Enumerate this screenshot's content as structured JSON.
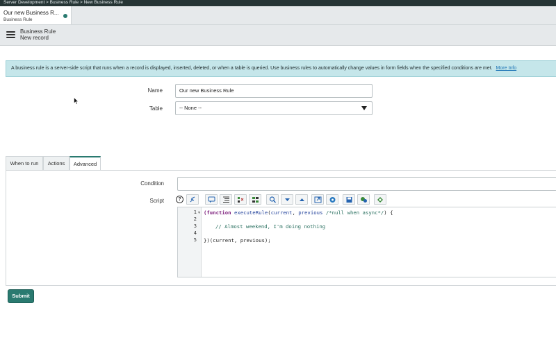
{
  "breadcrumb": "Server Development > Business Rule > New Business Rule",
  "doc_tab": {
    "title": "Our new Business R...",
    "subtitle": "Business Rule"
  },
  "form_header": {
    "title": "Business Rule",
    "subtitle": "New record"
  },
  "info_banner": {
    "text": "A business rule is a server-side script that runs when a record is displayed, inserted, deleted, or when a table is queried. Use business rules to automatically change values in form fields when the specified conditions are met.",
    "more_link": "More Info"
  },
  "fields": {
    "name": {
      "label": "Name",
      "value": "Our new Business Rule"
    },
    "table": {
      "label": "Table",
      "value": "-- None --"
    }
  },
  "tabs": [
    {
      "label": "When to run"
    },
    {
      "label": "Actions"
    },
    {
      "label": "Advanced",
      "active": true
    }
  ],
  "advanced": {
    "condition_label": "Condition",
    "condition_value": "",
    "script_label": "Script",
    "toolbar_icons": [
      "help-icon",
      "syntax-check-icon",
      "comment-icon",
      "format-icon",
      "replace-icon",
      "replace-all-icon",
      "search-icon",
      "find-next-icon",
      "find-prev-icon",
      "fullscreen-icon",
      "script-debugger-icon",
      "save-icon",
      "toggle-syntax-icon",
      "script-include-icon"
    ],
    "script": {
      "line_numbers": [
        "1",
        "2",
        "3",
        "4",
        "5"
      ],
      "line1": {
        "kw": "(function",
        "fn": "executeRule",
        "open": "(",
        "arg1": "current",
        "comma": ", ",
        "arg2": "previous",
        "comment": "/*null when async*/",
        "close": ") {"
      },
      "line3": "// Almost weekend, I'm doing nothing",
      "line5": "})(current, previous);"
    }
  },
  "submit_label": "Submit",
  "colors": {
    "accent": "#2a7a70",
    "info_bg": "#c5e6ea",
    "topbar": "#263535"
  }
}
